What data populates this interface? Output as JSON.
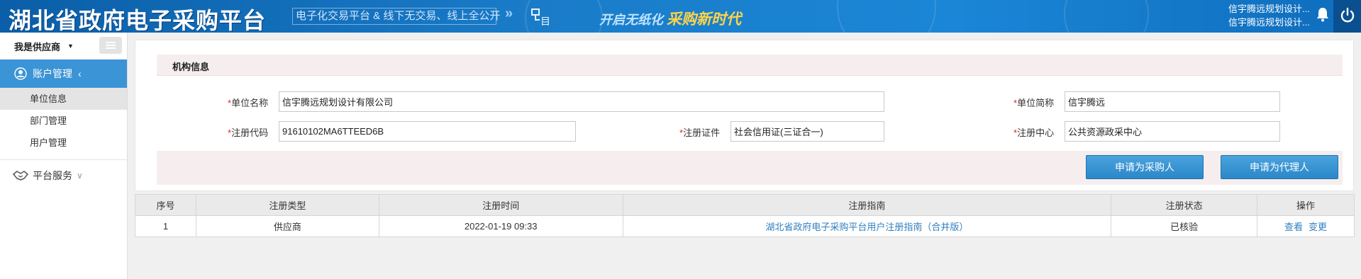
{
  "header": {
    "title": "湖北省政府电子采购平台",
    "slogan": "电子化交易平台 & 线下无交易、线上全公开",
    "slogan2_prefix": "开启无纸化",
    "slogan2_highlight": "采购新时代",
    "user_line1": "信宇腾远规划设计...",
    "user_line2": "信宇腾远规划设计...",
    "bell_icon": "bell-icon",
    "power_icon": "power-icon"
  },
  "sidebar": {
    "role_label": "我是供应商",
    "account_menu": "账户管理",
    "sub_items": [
      {
        "label": "单位信息"
      },
      {
        "label": "部门管理"
      },
      {
        "label": "用户管理"
      }
    ],
    "platform_menu": "平台服务",
    "accent": "#3b94d6"
  },
  "org_info": {
    "section_title": "机构信息",
    "unit_name_label": "单位名称",
    "unit_name_value": "信宇腾远规划设计有限公司",
    "short_name_label": "单位简称",
    "short_name_value": "信宇腾远",
    "reg_code_label": "注册代码",
    "reg_code_value": "91610102MA6TTEED6B",
    "reg_cert_label": "注册证件",
    "reg_cert_value": "社会信用证(三证合一)",
    "reg_center_label": "注册中心",
    "reg_center_value": "公共资源政采中心",
    "apply_purchaser": "申请为采购人",
    "apply_agent": "申请为代理人"
  },
  "table": {
    "headers": [
      "序号",
      "注册类型",
      "注册时间",
      "注册指南",
      "注册状态",
      "操作"
    ],
    "rows": [
      {
        "index": "1",
        "type": "供应商",
        "time": "2022-01-19 09:33",
        "guide": "湖北省政府电子采购平台用户注册指南（合并版）",
        "status": "已核验",
        "op_view": "查看",
        "op_change": "变更"
      }
    ]
  }
}
